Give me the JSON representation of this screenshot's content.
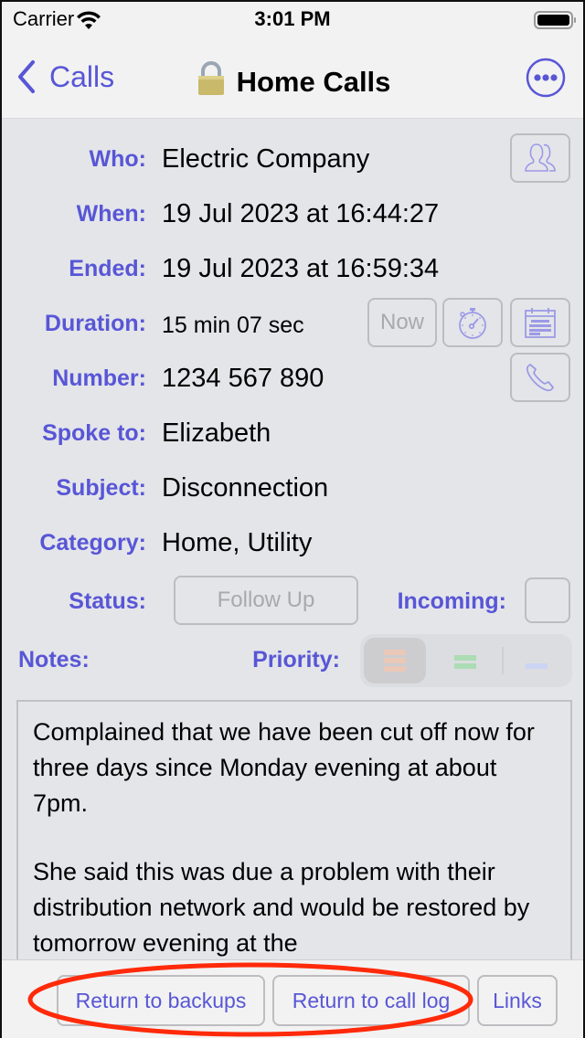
{
  "status_bar": {
    "carrier": "Carrier",
    "time": "3:01 PM"
  },
  "nav": {
    "back_label": "Calls",
    "title": "Home Calls",
    "accent_color": "#5856d6"
  },
  "fields": {
    "who": {
      "label": "Who:",
      "value": "Electric Company"
    },
    "when": {
      "label": "When:",
      "value": "19 Jul 2023 at 16:44:27"
    },
    "ended": {
      "label": "Ended:",
      "value": "19 Jul 2023 at 16:59:34"
    },
    "duration": {
      "label": "Duration:",
      "value": "15 min 07 sec",
      "now_label": "Now"
    },
    "number": {
      "label": "Number:",
      "value": "1234 567 890"
    },
    "spoke_to": {
      "label": "Spoke to:",
      "value": "Elizabeth"
    },
    "subject": {
      "label": "Subject:",
      "value": "Disconnection"
    },
    "category": {
      "label": "Category:",
      "value": "Home, Utility"
    },
    "status": {
      "label": "Status:",
      "value": "Follow Up"
    },
    "incoming": {
      "label": "Incoming:",
      "checked": false
    },
    "notes": {
      "label": "Notes:"
    },
    "priority": {
      "label": "Priority:",
      "selected": "high",
      "options": [
        {
          "name": "high",
          "color": "#eac8b8"
        },
        {
          "name": "medium",
          "color": "#acdcb4"
        },
        {
          "name": "low",
          "color": "#ccd4f4"
        }
      ]
    }
  },
  "notes_text": {
    "p1": "Complained that we have been cut off now for three days since Monday evening at about 7pm.",
    "p2": "She said this was due a problem with their distribution network and would be restored by tomorrow evening at the"
  },
  "toolbar": {
    "return_backups": "Return to backups",
    "return_call_log": "Return to call log",
    "links": "Links"
  }
}
